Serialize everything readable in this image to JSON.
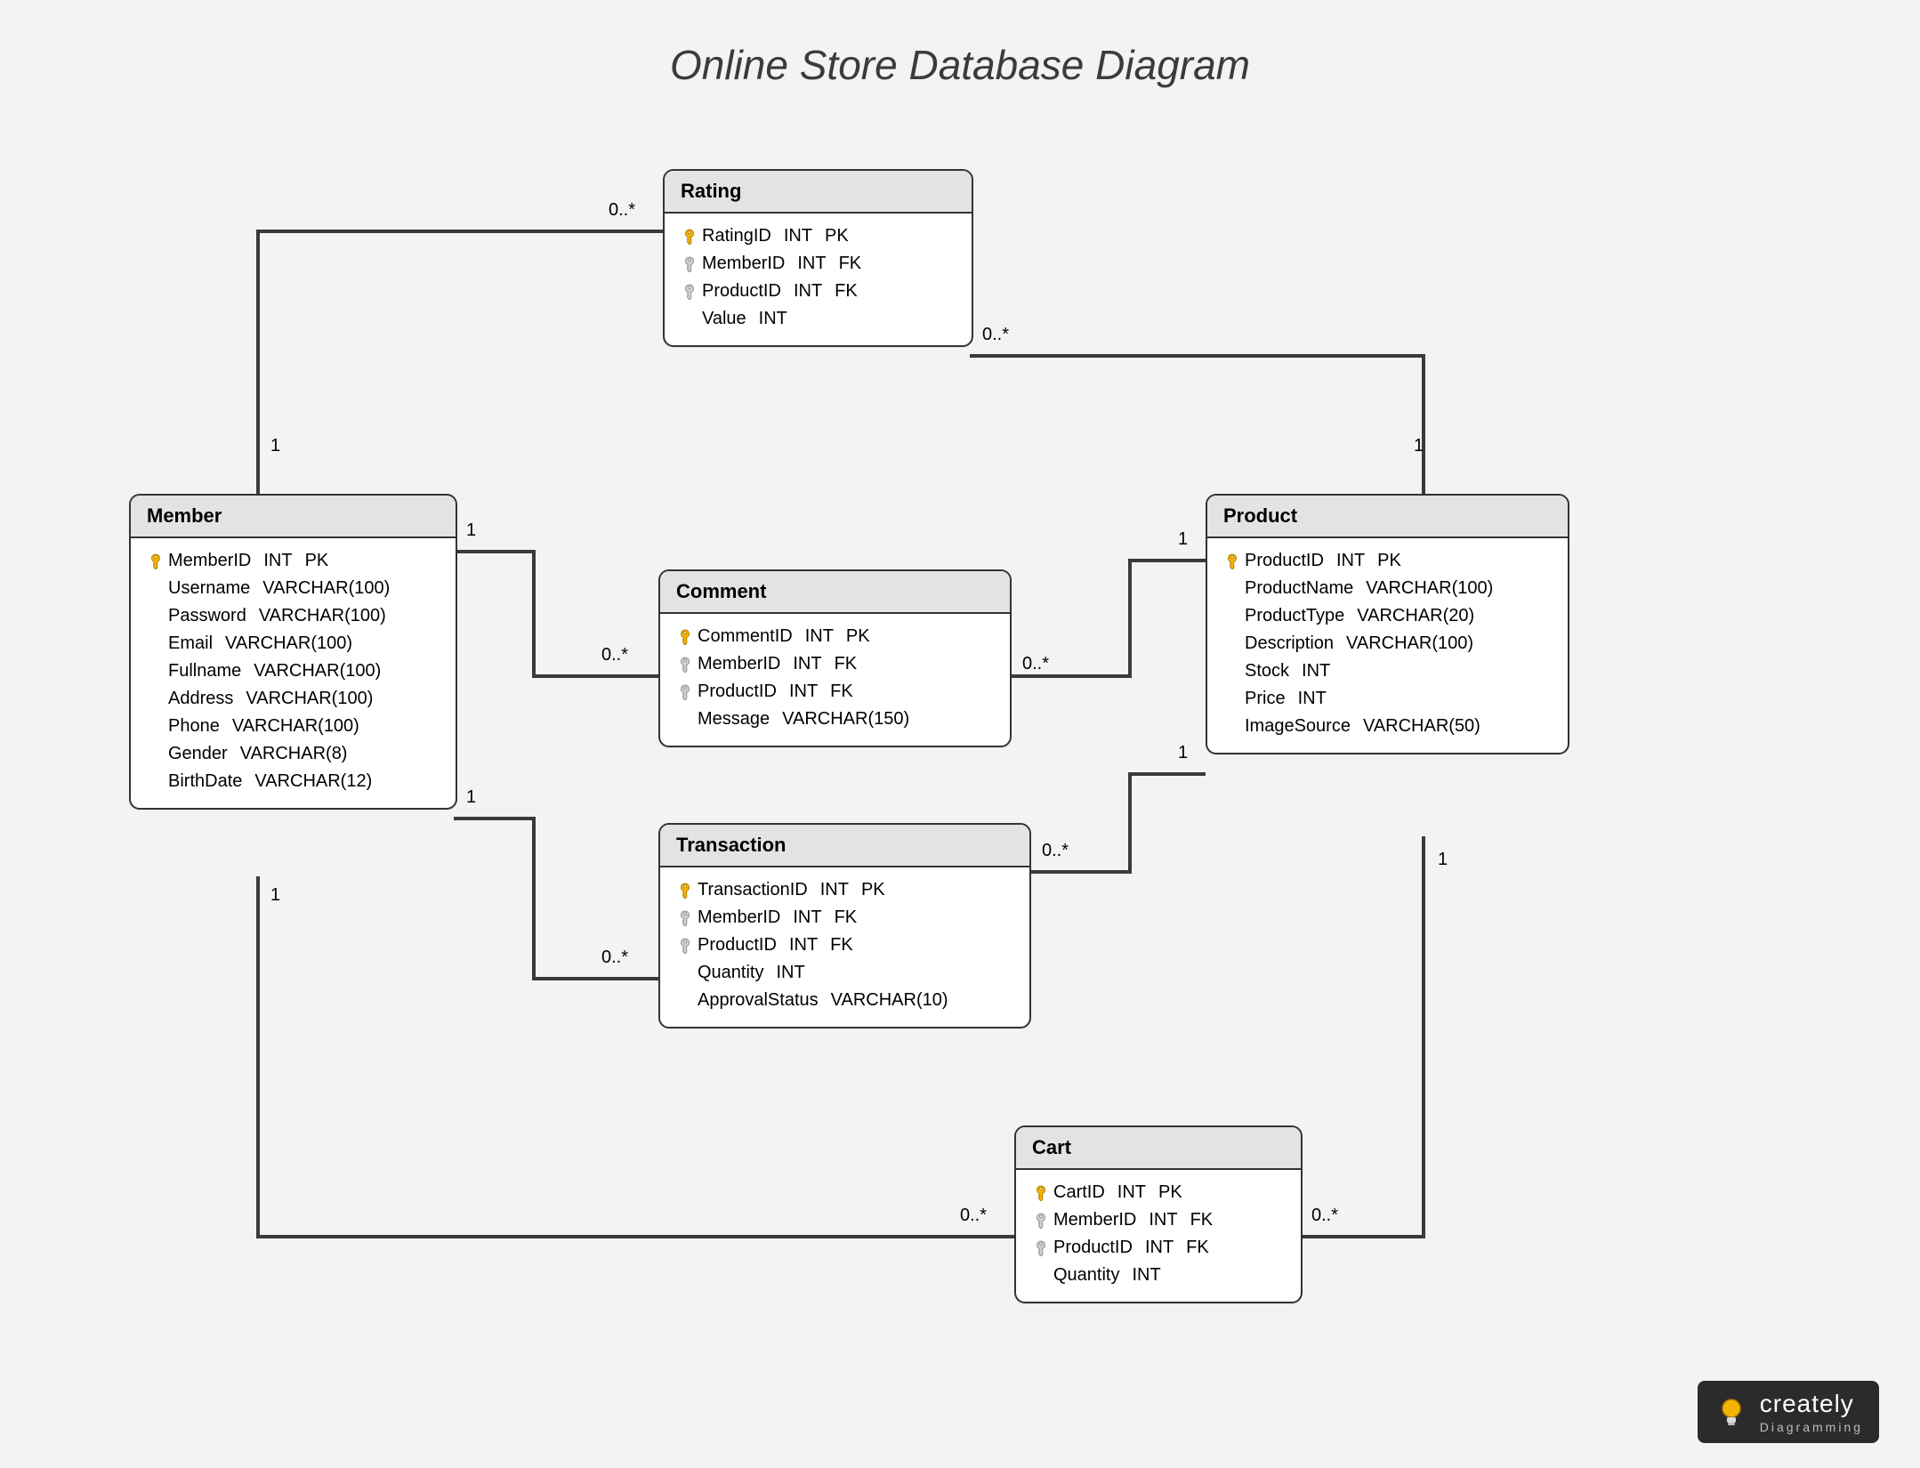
{
  "title": "Online Store Database Diagram",
  "logo": {
    "name": "creately",
    "tagline": "Diagramming"
  },
  "entities": {
    "member": {
      "name": "Member",
      "fields": [
        {
          "name": "MemberID",
          "type": "INT",
          "role": "PK",
          "key": "pk"
        },
        {
          "name": "Username",
          "type": "VARCHAR(100)",
          "role": "",
          "key": ""
        },
        {
          "name": "Password",
          "type": "VARCHAR(100)",
          "role": "",
          "key": ""
        },
        {
          "name": "Email",
          "type": "VARCHAR(100)",
          "role": "",
          "key": ""
        },
        {
          "name": "Fullname",
          "type": "VARCHAR(100)",
          "role": "",
          "key": ""
        },
        {
          "name": "Address",
          "type": "VARCHAR(100)",
          "role": "",
          "key": ""
        },
        {
          "name": "Phone",
          "type": "VARCHAR(100)",
          "role": "",
          "key": ""
        },
        {
          "name": "Gender",
          "type": "VARCHAR(8)",
          "role": "",
          "key": ""
        },
        {
          "name": "BirthDate",
          "type": "VARCHAR(12)",
          "role": "",
          "key": ""
        }
      ]
    },
    "rating": {
      "name": "Rating",
      "fields": [
        {
          "name": "RatingID",
          "type": "INT",
          "role": "PK",
          "key": "pk"
        },
        {
          "name": "MemberID",
          "type": "INT",
          "role": "FK",
          "key": "fk"
        },
        {
          "name": "ProductID",
          "type": "INT",
          "role": "FK",
          "key": "fk"
        },
        {
          "name": "Value",
          "type": "INT",
          "role": "",
          "key": ""
        }
      ]
    },
    "comment": {
      "name": "Comment",
      "fields": [
        {
          "name": "CommentID",
          "type": "INT",
          "role": "PK",
          "key": "pk"
        },
        {
          "name": "MemberID",
          "type": "INT",
          "role": "FK",
          "key": "fk"
        },
        {
          "name": "ProductID",
          "type": "INT",
          "role": "FK",
          "key": "fk"
        },
        {
          "name": "Message",
          "type": "VARCHAR(150)",
          "role": "",
          "key": ""
        }
      ]
    },
    "transaction": {
      "name": "Transaction",
      "fields": [
        {
          "name": "TransactionID",
          "type": "INT",
          "role": "PK",
          "key": "pk"
        },
        {
          "name": "MemberID",
          "type": "INT",
          "role": "FK",
          "key": "fk"
        },
        {
          "name": "ProductID",
          "type": "INT",
          "role": "FK",
          "key": "fk"
        },
        {
          "name": "Quantity",
          "type": "INT",
          "role": "",
          "key": ""
        },
        {
          "name": "ApprovalStatus",
          "type": "VARCHAR(10)",
          "role": "",
          "key": ""
        }
      ]
    },
    "product": {
      "name": "Product",
      "fields": [
        {
          "name": "ProductID",
          "type": "INT",
          "role": "PK",
          "key": "pk"
        },
        {
          "name": "ProductName",
          "type": "VARCHAR(100)",
          "role": "",
          "key": ""
        },
        {
          "name": "ProductType",
          "type": "VARCHAR(20)",
          "role": "",
          "key": ""
        },
        {
          "name": "Description",
          "type": "VARCHAR(100)",
          "role": "",
          "key": ""
        },
        {
          "name": "Stock",
          "type": "INT",
          "role": "",
          "key": ""
        },
        {
          "name": "Price",
          "type": "INT",
          "role": "",
          "key": ""
        },
        {
          "name": "ImageSource",
          "type": "VARCHAR(50)",
          "role": "",
          "key": ""
        }
      ]
    },
    "cart": {
      "name": "Cart",
      "fields": [
        {
          "name": "CartID",
          "type": "INT",
          "role": "PK",
          "key": "pk"
        },
        {
          "name": "MemberID",
          "type": "INT",
          "role": "FK",
          "key": "fk"
        },
        {
          "name": "ProductID",
          "type": "INT",
          "role": "FK",
          "key": "fk"
        },
        {
          "name": "Quantity",
          "type": "INT",
          "role": "",
          "key": ""
        }
      ]
    }
  },
  "relationships": [
    {
      "from": "Member",
      "to": "Rating",
      "from_card": "1",
      "to_card": "0..*"
    },
    {
      "from": "Member",
      "to": "Comment",
      "from_card": "1",
      "to_card": "0..*"
    },
    {
      "from": "Member",
      "to": "Transaction",
      "from_card": "1",
      "to_card": "0..*"
    },
    {
      "from": "Member",
      "to": "Cart",
      "from_card": "1",
      "to_card": "0..*"
    },
    {
      "from": "Product",
      "to": "Rating",
      "from_card": "1",
      "to_card": "0..*"
    },
    {
      "from": "Product",
      "to": "Comment",
      "from_card": "1",
      "to_card": "0..*"
    },
    {
      "from": "Product",
      "to": "Transaction",
      "from_card": "1",
      "to_card": "0..*"
    },
    {
      "from": "Product",
      "to": "Cart",
      "from_card": "1",
      "to_card": "0..*"
    }
  ],
  "cards": {
    "memR1": "1",
    "memR2": "0..*",
    "memC1": "1",
    "memC2": "0..*",
    "memT1": "1",
    "memT2": "0..*",
    "memCa1": "1",
    "memCa2": "0..*",
    "prR1": "1",
    "prR2": "0..*",
    "prC1": "1",
    "prC2": "0..*",
    "prT1": "1",
    "prT2": "0..*",
    "prCa1": "1",
    "prCa2": "0..*"
  }
}
